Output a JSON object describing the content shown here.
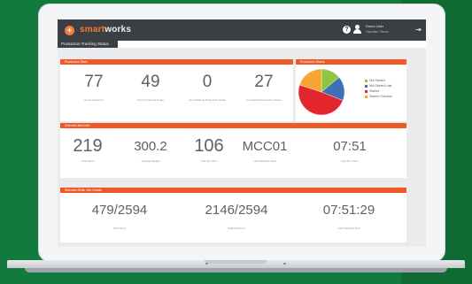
{
  "app": {
    "logo_mark": "+",
    "logo_prefix": "smart",
    "logo_suffix": "works",
    "tab_label": "Production Tracking Status",
    "help_icon": "?",
    "logout_icon": "⇥",
    "user": {
      "name": "Demo User",
      "role": "Operator / Demo"
    }
  },
  "production_stats": {
    "title": "Production Stats",
    "items": [
      {
        "value": "77",
        "label": "Items Produced"
      },
      {
        "value": "49",
        "label": "Items Produced Today"
      },
      {
        "value": "0",
        "label": "Items Waiting Production Today"
      },
      {
        "value": "27",
        "label": "Completed Production Orders"
      }
    ]
  },
  "status_chart": {
    "title": "Production Status",
    "chart_data": {
      "type": "pie",
      "title": "Production Status",
      "slices": [
        {
          "name": "Not Started",
          "value": 14,
          "color": "#8dc63f"
        },
        {
          "name": "Not Started Late",
          "value": 17,
          "color": "#3f6fb6"
        },
        {
          "name": "Started",
          "value": 49,
          "color": "#e3262d"
        },
        {
          "name": "Started Overdue",
          "value": 20,
          "color": "#f7a531"
        }
      ],
      "legend_position": "right"
    }
  },
  "last_item": {
    "title": "Selected Item Info",
    "items": [
      {
        "value": "219",
        "label": "Total Items"
      },
      {
        "value": "300.2",
        "label": "Average Weight"
      },
      {
        "value": "106",
        "label": "Last Item Item"
      },
      {
        "value": "MCC01",
        "label": "Last Machine Used"
      },
      {
        "value": "07:51",
        "label": "Last Item Time"
      }
    ]
  },
  "last_order": {
    "title": "Selected Order Info Details",
    "items": [
      {
        "value": "479/2594",
        "label": "Total Items"
      },
      {
        "value": "2146/2594",
        "label": "Selected Items"
      },
      {
        "value": "07:51:29",
        "label": "Last Selected Time"
      }
    ]
  },
  "colors": {
    "accent": "#f05a28",
    "app_bar": "#3b3f44",
    "background": "#127a3c"
  }
}
